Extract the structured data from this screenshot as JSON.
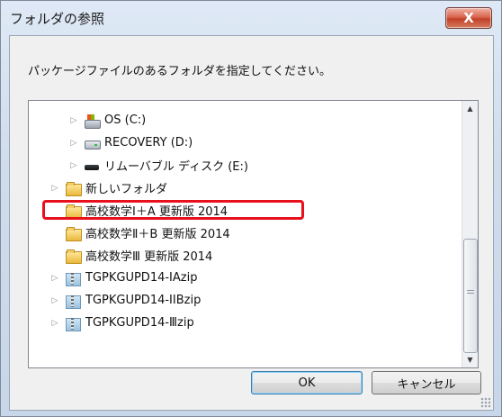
{
  "window": {
    "title": "フォルダの参照",
    "close_glyph": "X"
  },
  "dialog": {
    "description": "パッケージファイルのあるフォルダを指定してください。"
  },
  "tree": {
    "items": [
      {
        "label": "OS (C:)",
        "icon": "drive-os-icon",
        "expander": "▷"
      },
      {
        "label": "RECOVERY (D:)",
        "icon": "drive-icon",
        "expander": "▷"
      },
      {
        "label": "リムーバブル ディスク (E:)",
        "icon": "removable-icon",
        "expander": "▷"
      },
      {
        "label": "新しいフォルダ",
        "icon": "folder-icon",
        "expander": "▷"
      },
      {
        "label": "高校数学Ⅰ＋A 更新版 2014",
        "icon": "folder-icon",
        "expander": "",
        "highlighted": true
      },
      {
        "label": "高校数学Ⅱ＋B 更新版 2014",
        "icon": "folder-icon",
        "expander": ""
      },
      {
        "label": "高校数学Ⅲ 更新版 2014",
        "icon": "folder-icon",
        "expander": ""
      },
      {
        "label": "TGPKGUPD14-IAzip",
        "icon": "zip-icon",
        "expander": "▷"
      },
      {
        "label": "TGPKGUPD14-IIBzip",
        "icon": "zip-icon",
        "expander": "▷"
      },
      {
        "label": "TGPKGUPD14-Ⅲzip",
        "icon": "zip-icon",
        "expander": "▷"
      }
    ]
  },
  "scrollbar": {
    "up_glyph": "▲",
    "down_glyph": "▼"
  },
  "buttons": {
    "ok": "OK",
    "cancel": "キャンセル"
  },
  "colors": {
    "highlight_border": "#e8101c",
    "ok_border": "#3c7fb1"
  }
}
